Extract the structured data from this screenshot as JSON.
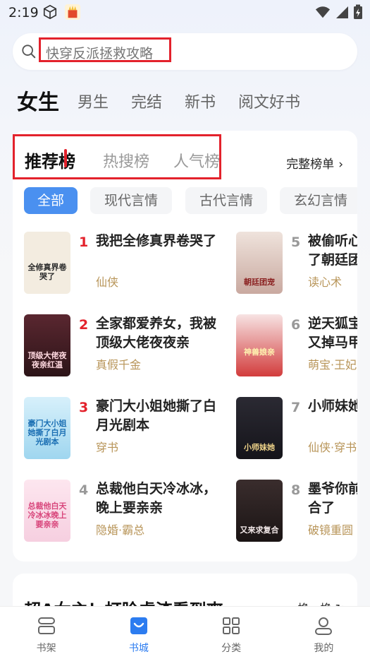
{
  "status_bar": {
    "time": "2:19"
  },
  "search": {
    "placeholder": "快穿反派拯救攻略"
  },
  "channels": [
    {
      "label": "女生",
      "active": true
    },
    {
      "label": "男生"
    },
    {
      "label": "完结"
    },
    {
      "label": "新书"
    },
    {
      "label": "阅文好书"
    }
  ],
  "rank": {
    "tabs": [
      {
        "label": "推荐榜",
        "active": true
      },
      {
        "label": "热搜榜"
      },
      {
        "label": "人气榜"
      }
    ],
    "full_list_label": "完整榜单",
    "filters": [
      "全部",
      "现代言情",
      "古代言情",
      "玄幻言情"
    ],
    "books": [
      {
        "rank": "1",
        "title": "我把全修真界卷哭了",
        "tag": "仙侠",
        "cover_text": "全修真界卷哭了"
      },
      {
        "rank": "2",
        "title": "全家都爱养女，我被顶级大佬夜夜亲",
        "tag": "真假千金",
        "cover_text": "顶级大佬夜夜亲红温"
      },
      {
        "rank": "3",
        "title": "豪门大小姐她撕了白月光剧本",
        "tag": "穿书",
        "cover_text": "豪门大小姐她撕了白月光剧本"
      },
      {
        "rank": "4",
        "title": "总裁他白天冷冰冰，晚上要亲亲",
        "tag": "隐婚·霸总",
        "cover_text": "总裁他白天冷冰冰晚上要亲亲"
      },
      {
        "rank": "5",
        "title": "被偷听心声后，我成了朝廷团宠",
        "tag": "读心术",
        "cover_text": "朝廷团宠"
      },
      {
        "rank": "6",
        "title": "逆天狐宝：神兽娘亲又掉马甲了",
        "tag": "萌宝·王妃",
        "cover_text": "神兽娘亲"
      },
      {
        "rank": "7",
        "title": "小师妹她又在搞事",
        "tag": "仙侠·穿书",
        "cover_text": "小师妹她"
      },
      {
        "rank": "8",
        "title": "墨爷你前妻又来求复合了",
        "tag": "破镜重圆",
        "cover_text": "又来求复合"
      }
    ]
  },
  "next_section": {
    "title": "超A女主！打脸虐渣看到爽",
    "refresh_label": "换一换"
  },
  "bottom_nav": [
    {
      "label": "书架"
    },
    {
      "label": "书城",
      "active": true
    },
    {
      "label": "分类"
    },
    {
      "label": "我的"
    }
  ],
  "colors": {
    "accent": "#2c7cf0",
    "rank_red": "#e3222c",
    "tag_gold": "#b89559"
  }
}
